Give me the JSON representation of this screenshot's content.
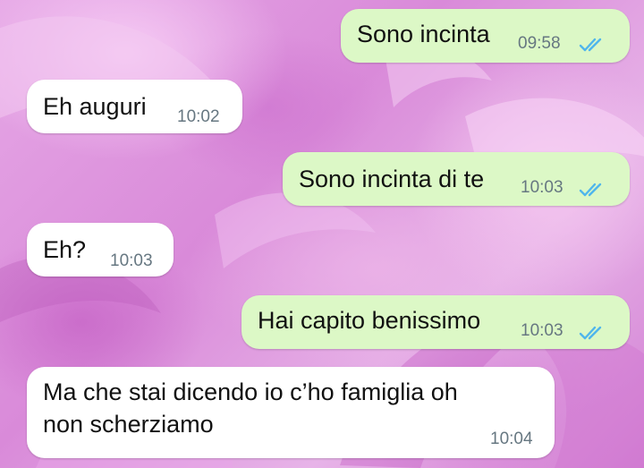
{
  "colors": {
    "outgoing_bubble": "#dcf8c6",
    "incoming_bubble": "#ffffff",
    "read_ticks": "#4fb6ec",
    "timestamp": "#667781"
  },
  "messages": [
    {
      "direction": "outgoing",
      "text": "Sono incinta",
      "time": "09:58",
      "status": "read"
    },
    {
      "direction": "incoming",
      "text": "Eh auguri",
      "time": "10:02"
    },
    {
      "direction": "outgoing",
      "text": "Sono incinta di te",
      "time": "10:03",
      "status": "read"
    },
    {
      "direction": "incoming",
      "text": "Eh?",
      "time": "10:03"
    },
    {
      "direction": "outgoing",
      "text": "Hai capito benissimo",
      "time": "10:03",
      "status": "read"
    },
    {
      "direction": "incoming",
      "text_line1": "Ma che stai dicendo io c’ho famiglia oh",
      "text_line2": "non scherziamo",
      "time": "10:04"
    }
  ]
}
